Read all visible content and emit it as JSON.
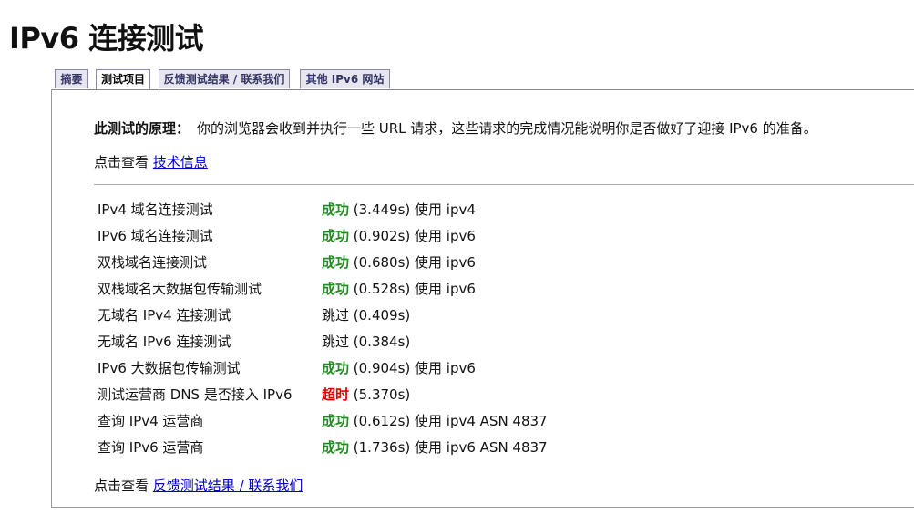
{
  "page": {
    "title": "IPv6 连接测试"
  },
  "tabs": [
    {
      "label": "摘要",
      "active": false
    },
    {
      "label": "测试项目",
      "active": true
    },
    {
      "label": "反馈测试结果 / 联系我们",
      "active": false
    },
    {
      "label": "其他 IPv6 网站",
      "active": false
    }
  ],
  "principle": {
    "label": "此测试的原理：",
    "text": "你的浏览器会收到并执行一些 URL 请求，这些请求的完成情况能说明你是否做好了迎接 IPv6 的准备。"
  },
  "tech_info": {
    "prefix": "点击查看",
    "link": "技术信息"
  },
  "results": [
    {
      "name": "IPv4 域名连接测试",
      "status": "成功",
      "kind": "ok",
      "detail": " (3.449s) 使用 ipv4"
    },
    {
      "name": "IPv6 域名连接测试",
      "status": "成功",
      "kind": "ok",
      "detail": " (0.902s) 使用 ipv6"
    },
    {
      "name": "双栈域名连接测试",
      "status": "成功",
      "kind": "ok",
      "detail": " (0.680s) 使用 ipv6"
    },
    {
      "name": "双栈域名大数据包传输测试",
      "status": "成功",
      "kind": "ok",
      "detail": " (0.528s) 使用 ipv6"
    },
    {
      "name": "无域名 IPv4 连接测试",
      "status": "跳过",
      "kind": "skip",
      "detail": " (0.409s)"
    },
    {
      "name": "无域名 IPv6 连接测试",
      "status": "跳过",
      "kind": "skip",
      "detail": " (0.384s)"
    },
    {
      "name": "IPv6 大数据包传输测试",
      "status": "成功",
      "kind": "ok",
      "detail": " (0.904s) 使用 ipv6"
    },
    {
      "name": "测试运营商 DNS 是否接入 IPv6",
      "status": "超时",
      "kind": "timeout",
      "detail": " (5.370s)"
    },
    {
      "name": "查询 IPv4 运营商",
      "status": "成功",
      "kind": "ok",
      "detail": " (0.612s) 使用 ipv4 ASN 4837"
    },
    {
      "name": "查询 IPv6 运营商",
      "status": "成功",
      "kind": "ok",
      "detail": " (1.736s) 使用 ipv6 ASN 4837"
    }
  ],
  "feedback": {
    "prefix": "点击查看",
    "link": "反馈测试结果 / 联系我们"
  },
  "colors": {
    "success": "#228b22",
    "timeout": "#dd0000",
    "link": "#0000cc"
  }
}
